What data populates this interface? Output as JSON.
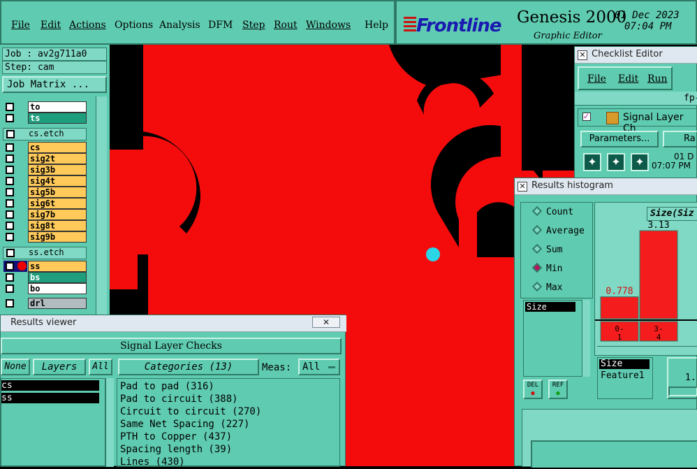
{
  "menubar": {
    "items": [
      "File",
      "Edit",
      "Actions",
      "Options",
      "Analysis",
      "DFM",
      "Step",
      "Rout",
      "Windows",
      "Help"
    ]
  },
  "brand": {
    "logo": "Frontline",
    "product": "Genesis 2000",
    "subtitle": "Graphic Editor",
    "date": "01 Dec 2023",
    "time": "07:04 PM"
  },
  "job": {
    "job_label": "Job : av2g711a0",
    "step_label": "Step: cam",
    "matrix_button": "Job Matrix ..."
  },
  "layers": [
    {
      "name": "to",
      "color": "w"
    },
    {
      "name": "ts",
      "color": "g"
    },
    {
      "name": "cs.etch",
      "color": "sep"
    },
    {
      "name": "cs",
      "color": "y"
    },
    {
      "name": "sig2t",
      "color": "y"
    },
    {
      "name": "sig3b",
      "color": "y"
    },
    {
      "name": "sig4t",
      "color": "y"
    },
    {
      "name": "sig5b",
      "color": "y"
    },
    {
      "name": "sig6t",
      "color": "y"
    },
    {
      "name": "sig7b",
      "color": "y"
    },
    {
      "name": "sig8t",
      "color": "y"
    },
    {
      "name": "sig9b",
      "color": "y"
    },
    {
      "name": "ss.etch",
      "color": "sep"
    },
    {
      "name": "ss",
      "color": "y"
    },
    {
      "name": "bs",
      "color": "g"
    },
    {
      "name": "bo",
      "color": "w"
    },
    {
      "name": "drl",
      "color": "gr"
    }
  ],
  "checklist": {
    "title": "Checklist Editor",
    "menu": [
      "File",
      "Edit",
      "Run"
    ],
    "name_fragment": "fp-",
    "item_label": "Signal Layer Ch",
    "params_button": "Parameters...",
    "range_button": "Ra",
    "date_fragment": "01 D",
    "time_fragment": "07:07 PM"
  },
  "histogram": {
    "title": "Results histogram",
    "modes": [
      "Count",
      "Average",
      "Sum",
      "Min",
      "Max"
    ],
    "selected_mode": "Min",
    "list_item": "Size",
    "chart_title": "Size(Siz",
    "bars": [
      {
        "value": "0.778",
        "range_top": "0-",
        "range_bot": "1"
      },
      {
        "value": "3.13",
        "range_top": "3-",
        "range_bot": "4"
      }
    ],
    "del_label": "DEL",
    "ref_label": "REF",
    "field1": "Size",
    "field2": "Feature1",
    "spin_value": "1."
  },
  "viewer": {
    "title": "Results viewer",
    "header": "Signal Layer Checks",
    "none_button": "None",
    "layers_label": "Layers",
    "all_button": "All",
    "categories_label": "Categories (13)",
    "meas_label": "Meas:",
    "meas_value": "All",
    "layer_items": [
      "cs",
      "ss"
    ],
    "categories": [
      "Pad to pad (316)",
      "Pad to circuit (388)",
      "Circuit to circuit (270)",
      "Same Net Spacing (227)",
      "PTH to Copper (437)",
      "Spacing length (39)",
      "Lines (430)"
    ]
  }
}
